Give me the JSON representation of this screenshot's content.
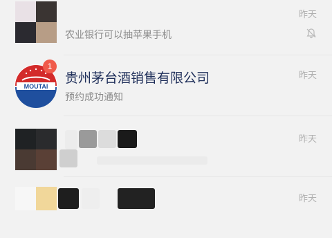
{
  "chats": [
    {
      "title": "",
      "preview": "农业银行可以抽苹果手机",
      "time": "昨天",
      "muted": true
    },
    {
      "title": "贵州茅台酒销售有限公司",
      "preview": "预约成功通知",
      "time": "昨天",
      "unread": "1",
      "avatar_text": "MOUTAI"
    },
    {
      "title": "",
      "preview": "",
      "time": "昨天"
    },
    {
      "title": "",
      "preview": "",
      "time": "昨天"
    }
  ],
  "colors": {
    "title": "#1f2f5a",
    "time": "#b0b0b0",
    "badge": "#f05a4a",
    "moutai_red": "#d32a2a",
    "moutai_blue": "#1f4f9e"
  }
}
